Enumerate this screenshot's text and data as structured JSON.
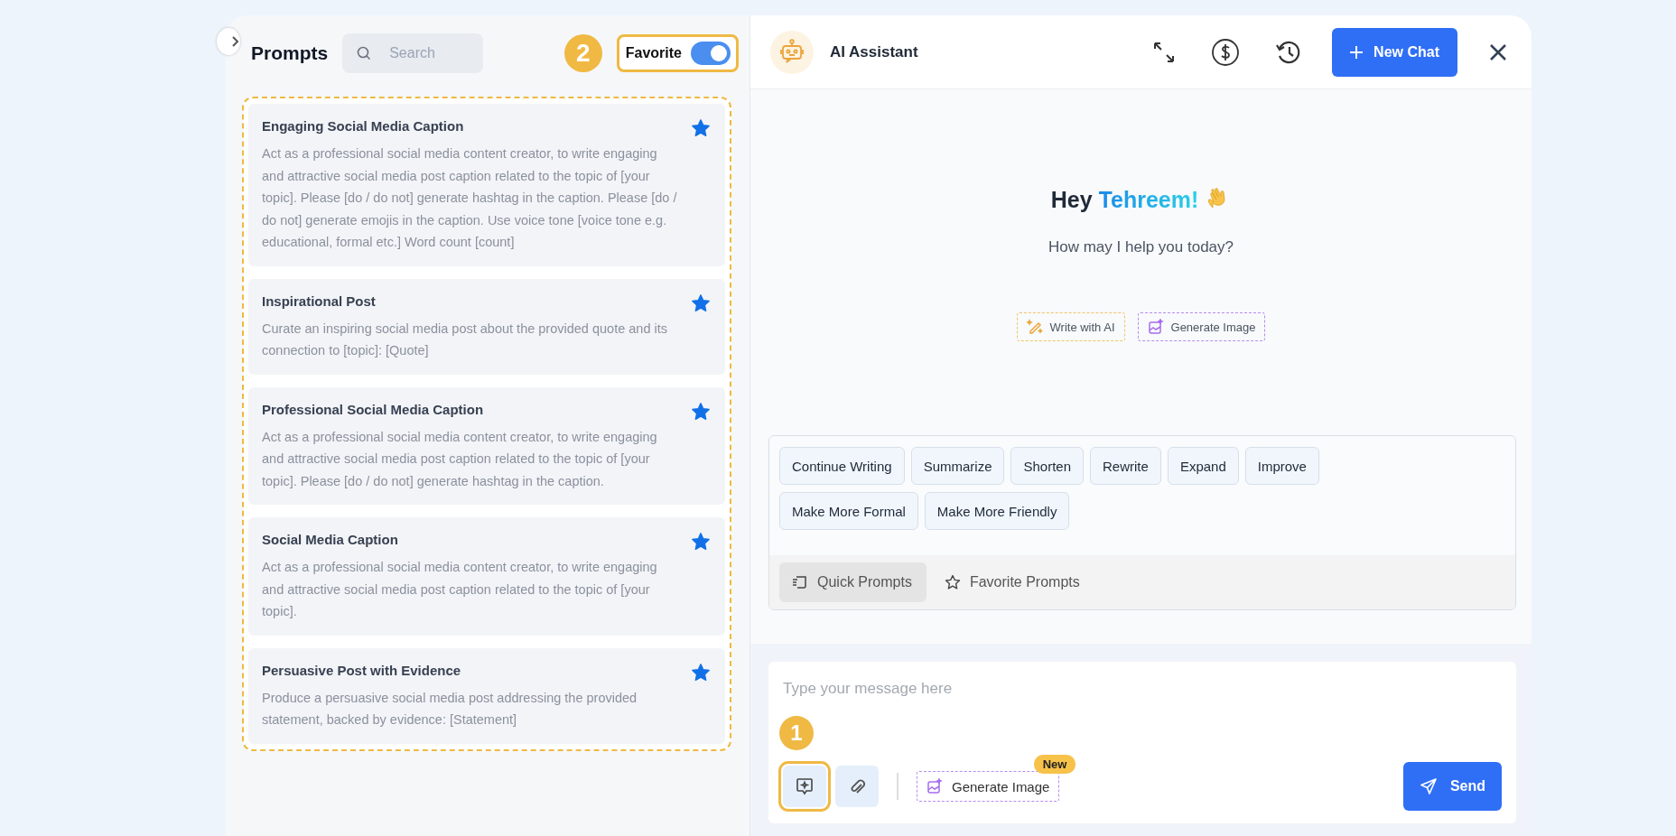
{
  "sidebar": {
    "title": "Prompts",
    "search": {
      "placeholder": "Search"
    },
    "favorite_filter": {
      "label": "Favorite",
      "on": true,
      "annotation": "2"
    },
    "prompts": [
      {
        "title": "Engaging Social Media Caption",
        "text": "Act as a professional social media content creator, to write engaging and attractive social media post caption related to the topic of [your topic]. Please [do / do not] generate hashtag in the caption. Please [do / do not] generate emojis in the caption. Use voice tone [voice tone e.g. educational, formal etc.] Word count [count]",
        "favorite": true
      },
      {
        "title": "Inspirational Post",
        "text": "Curate an inspiring social media post about the provided quote and its connection to [topic]: [Quote]",
        "favorite": true
      },
      {
        "title": "Professional Social Media Caption",
        "text": "Act as a professional social media content creator, to write engaging and attractive social media post caption related to the topic of [your topic]. Please [do / do not] generate hashtag in the caption.",
        "favorite": true
      },
      {
        "title": "Social Media Caption",
        "text": "Act as a professional social media content creator, to write engaging and attractive social media post caption related to the topic of [your topic].",
        "favorite": true
      },
      {
        "title": "Persuasive Post with Evidence",
        "text": "Produce a persuasive social media post addressing the provided statement, backed by evidence: [Statement]",
        "favorite": true
      }
    ]
  },
  "header": {
    "title": "AI Assistant",
    "new_chat": "New Chat"
  },
  "greeting": {
    "hello": "Hey",
    "name": "Tehreem!",
    "subtitle": "How may I help you today?"
  },
  "shortcuts": [
    {
      "kind": "write",
      "label": "Write with AI"
    },
    {
      "kind": "image",
      "label": "Generate Image"
    }
  ],
  "quick_actions": [
    "Continue Writing",
    "Summarize",
    "Shorten",
    "Rewrite",
    "Expand",
    "Improve",
    "Make More Formal",
    "Make More Friendly"
  ],
  "prompt_tabs": [
    {
      "kind": "quick",
      "label": "Quick Prompts",
      "selected": true
    },
    {
      "kind": "favorite",
      "label": "Favorite Prompts",
      "selected": false
    }
  ],
  "composer": {
    "placeholder": "Type your message here",
    "annotation": "1",
    "generate_image": "Generate Image",
    "badge": "New",
    "send": "Send"
  }
}
